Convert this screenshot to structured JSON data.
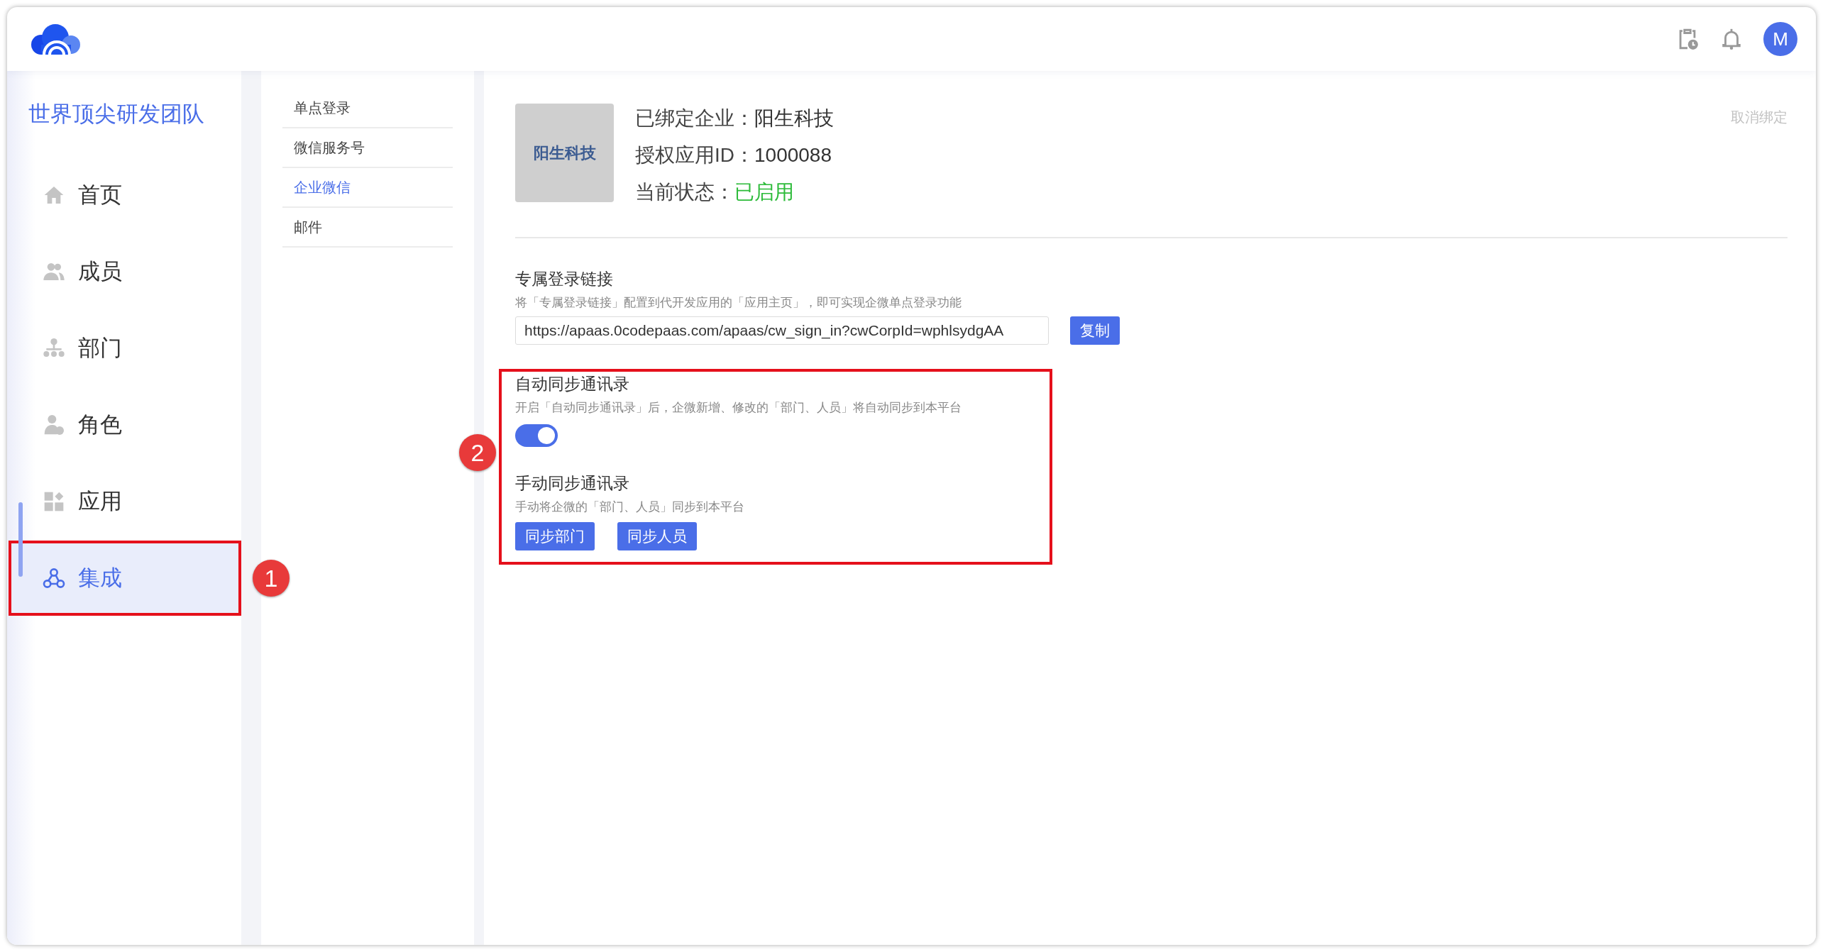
{
  "header": {
    "avatar": "M"
  },
  "sidebar": {
    "team": "世界顶尖研发团队",
    "items": [
      {
        "label": "首页",
        "selected": false
      },
      {
        "label": "成员",
        "selected": false
      },
      {
        "label": "部门",
        "selected": false
      },
      {
        "label": "角色",
        "selected": false
      },
      {
        "label": "应用",
        "selected": false
      },
      {
        "label": "集成",
        "selected": true,
        "callout": "1"
      }
    ]
  },
  "submenu": [
    {
      "label": "单点登录",
      "selected": false
    },
    {
      "label": "微信服务号",
      "selected": false
    },
    {
      "label": "企业微信",
      "selected": true
    },
    {
      "label": "邮件",
      "selected": false
    }
  ],
  "company": {
    "logo": "阳生科技",
    "unbind": "取消绑定",
    "lines": [
      {
        "label": "已绑定企业：",
        "value": "阳生科技",
        "kind": "plain"
      },
      {
        "label": "授权应用ID：",
        "value": "1000088",
        "kind": "plain"
      },
      {
        "label": "当前状态：",
        "value": "已启用",
        "kind": "status"
      }
    ]
  },
  "login_link": {
    "title": "专属登录链接",
    "description": "将「专属登录链接」配置到代开发应用的「应用主页」，即可实现企微单点登录功能",
    "value": "https://apaas.0codepaas.com/apaas/cw_sign_in?cwCorpId=wphlsydgAA",
    "button": "复制"
  },
  "sync": {
    "callout": "2",
    "auto": {
      "title": "自动同步通讯录",
      "description": "开启「自动同步通讯录」后，企微新增、修改的「部门、人员」将自动同步到本平台",
      "on": true
    },
    "manual": {
      "title": "手动同步通讯录",
      "description": "手动将企微的「部门、人员」同步到本平台",
      "buttons": [
        "同步部门",
        "同步人员"
      ]
    }
  }
}
